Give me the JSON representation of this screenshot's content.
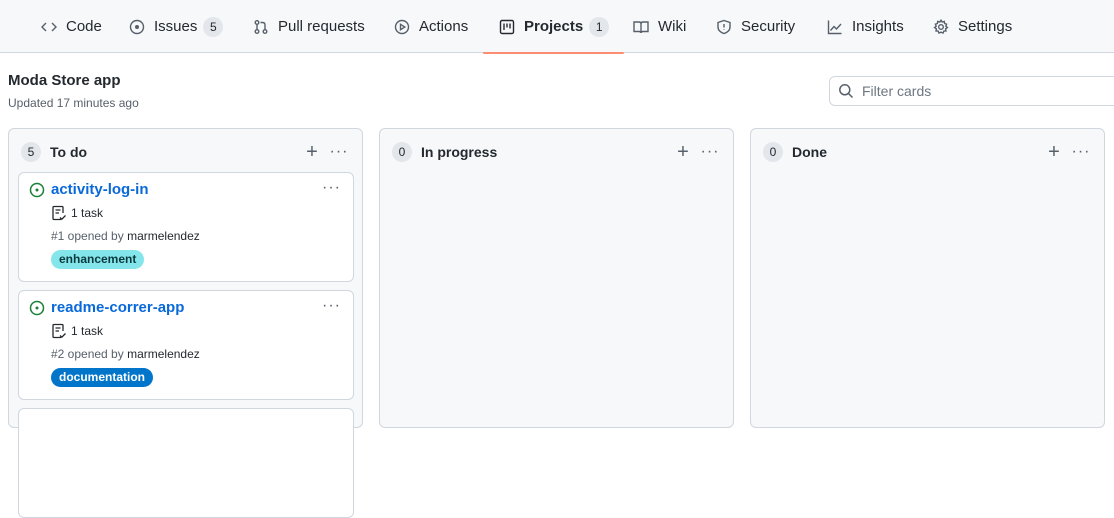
{
  "nav": {
    "tabs": [
      {
        "label": "Code",
        "icon": "code-icon"
      },
      {
        "label": "Issues",
        "count": "5",
        "icon": "issue-opened-icon"
      },
      {
        "label": "Pull requests",
        "icon": "git-pull-request-icon"
      },
      {
        "label": "Actions",
        "icon": "play-icon"
      },
      {
        "label": "Projects",
        "count": "1",
        "icon": "project-icon",
        "selected": true
      },
      {
        "label": "Wiki",
        "icon": "book-icon"
      },
      {
        "label": "Security",
        "icon": "shield-icon"
      },
      {
        "label": "Insights",
        "icon": "graph-icon"
      },
      {
        "label": "Settings",
        "icon": "gear-icon"
      }
    ]
  },
  "project": {
    "title": "Moda Store app",
    "updated": "Updated 17 minutes ago"
  },
  "filter": {
    "placeholder": "Filter cards",
    "value": ""
  },
  "columns": [
    {
      "name": "To do",
      "count": "5",
      "cards": [
        {
          "title": "activity-log-in",
          "tasks": "1 task",
          "meta_prefix": "#1 opened by ",
          "user": "marmelendez",
          "label": "enhancement",
          "label_bg": "#84e6eb",
          "label_fg": "#0b3a3d"
        },
        {
          "title": "readme-correr-app",
          "tasks": "1 task",
          "meta_prefix": "#2 opened by ",
          "user": "marmelendez",
          "label": "documentation",
          "label_bg": "#0075ca",
          "label_fg": "#ffffff"
        }
      ]
    },
    {
      "name": "In progress",
      "count": "0",
      "cards": []
    },
    {
      "name": "Done",
      "count": "0",
      "cards": []
    }
  ],
  "colors": {
    "accent_underline": "#fd8c73",
    "link": "#0969da",
    "issue_open": "#1a7f37"
  }
}
